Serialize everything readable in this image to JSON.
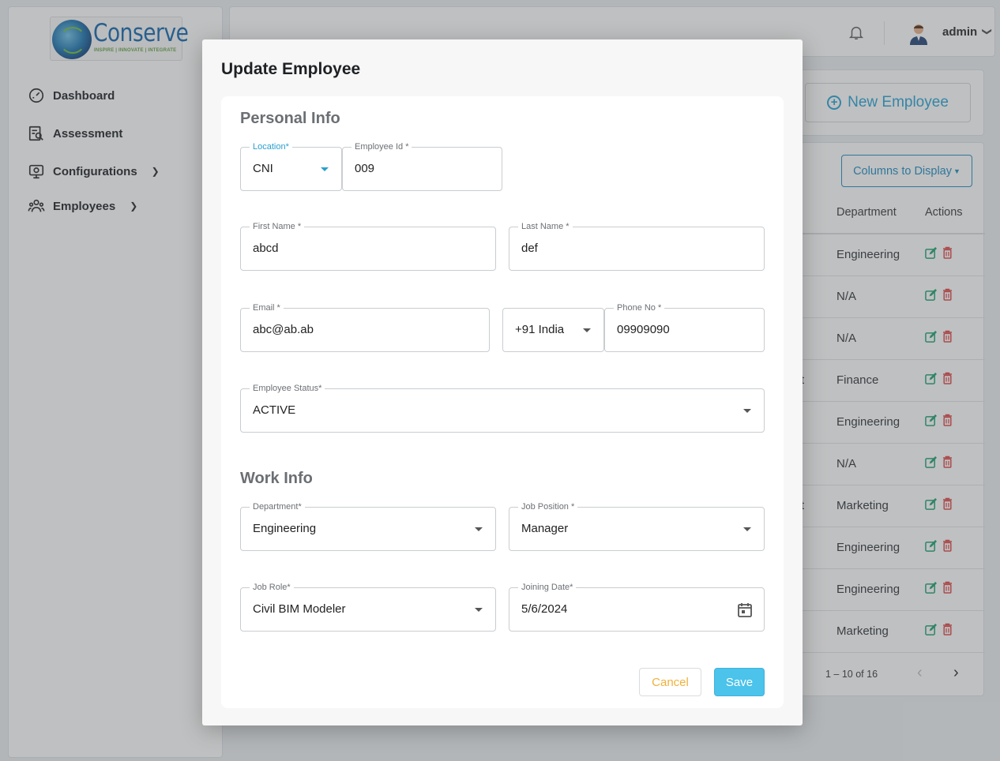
{
  "brand": {
    "logo_name": "Conserve",
    "logo_tagline": "INSPIRE | INNOVATE | INTEGRATE"
  },
  "sidebar": {
    "items": [
      {
        "label": "Dashboard",
        "icon": "dashboard-gauge-icon"
      },
      {
        "label": "Assessment",
        "icon": "assessment-icon"
      },
      {
        "label": "Configurations",
        "icon": "configurations-icon",
        "expandable": true
      },
      {
        "label": "Employees",
        "icon": "employees-icon",
        "expandable": true
      }
    ]
  },
  "header": {
    "username": "admin"
  },
  "actions": {
    "new_employee_label": "New Employee",
    "columns_label": "Columns to Display"
  },
  "table": {
    "headers": [
      "Department",
      "Actions"
    ],
    "rows": [
      {
        "frag": "",
        "department": "Engineering"
      },
      {
        "frag": "",
        "department": "N/A"
      },
      {
        "frag": "",
        "department": "N/A"
      },
      {
        "frag": "ist",
        "department": "Finance"
      },
      {
        "frag": "",
        "department": "Engineering"
      },
      {
        "frag": "",
        "department": "N/A"
      },
      {
        "frag": "ist",
        "department": "Marketing"
      },
      {
        "frag": "",
        "department": "Engineering"
      },
      {
        "frag": "",
        "department": "Engineering"
      },
      {
        "frag": "",
        "department": "Marketing"
      }
    ],
    "pagination": "1 – 10 of 16"
  },
  "modal": {
    "title": "Update Employee",
    "personal_section": "Personal Info",
    "work_section": "Work Info",
    "fields": {
      "location": {
        "label": "Location*",
        "value": "CNI"
      },
      "employee_id": {
        "label": "Employee Id *",
        "value": "009"
      },
      "first_name": {
        "label": "First Name *",
        "value": "abcd"
      },
      "last_name": {
        "label": "Last Name *",
        "value": "def"
      },
      "email": {
        "label": "Email *",
        "value": "abc@ab.ab"
      },
      "country_code": {
        "value": "+91 India"
      },
      "phone": {
        "label": "Phone No *",
        "value": "09909090"
      },
      "employee_status": {
        "label": "Employee Status*",
        "value": "ACTIVE"
      },
      "department": {
        "label": "Department*",
        "value": "Engineering"
      },
      "job_position": {
        "label": "Job Position *",
        "value": "Manager"
      },
      "job_role": {
        "label": "Job Role*",
        "value": "Civil BIM Modeler"
      },
      "joining_date": {
        "label": "Joining Date*",
        "value": "5/6/2024"
      }
    },
    "cancel_label": "Cancel",
    "save_label": "Save"
  },
  "colors": {
    "accent": "#31a8d8",
    "save": "#4bc3eb",
    "cancel_text": "#f1b13b",
    "edit_icon": "#2aa87a",
    "delete_icon": "#e05252"
  }
}
